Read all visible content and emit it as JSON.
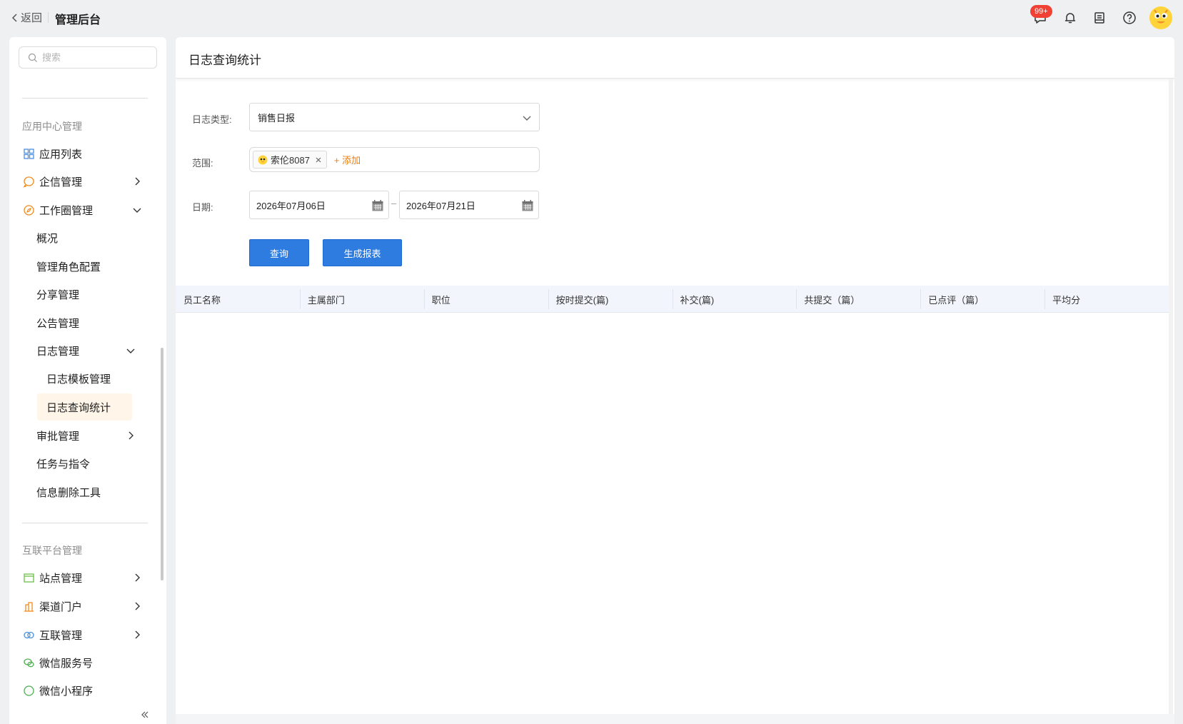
{
  "topbar": {
    "back_label": "返回",
    "app_title": "管理后台",
    "message_badge": "99+",
    "icons": [
      "chat-icon",
      "bell-icon",
      "notebook-icon",
      "help-icon",
      "avatar"
    ]
  },
  "sidebar": {
    "search_placeholder": "搜索",
    "group1_title": "应用中心管理",
    "items": [
      {
        "label": "应用列表",
        "icon": "grid-icon"
      },
      {
        "label": "企信管理",
        "icon": "message-icon"
      },
      {
        "label": "工作圈管理",
        "icon": "compass-icon"
      }
    ],
    "workcircle_children": [
      "概况",
      "管理角色配置",
      "分享管理",
      "公告管理",
      "日志管理"
    ],
    "log_children": [
      "日志模板管理",
      "日志查询统计"
    ],
    "more_children": [
      "审批管理",
      "任务与指令",
      "信息删除工具"
    ],
    "group2_title": "互联平台管理",
    "items2": [
      {
        "label": "站点管理",
        "icon": "window-icon"
      },
      {
        "label": "渠道门户",
        "icon": "building-icon"
      },
      {
        "label": "互联管理",
        "icon": "link-rings-icon"
      },
      {
        "label": "微信服务号",
        "icon": "wechat-icon"
      },
      {
        "label": "微信小程序",
        "icon": "miniprogram-icon"
      }
    ],
    "active_item": "日志查询统计",
    "colors": {
      "active_bg": "#fff5e8",
      "accent": "#e87f17"
    }
  },
  "main": {
    "page_title": "日志查询统计",
    "form": {
      "type_label": "日志类型:",
      "type_value": "销售日报",
      "range_label": "范围:",
      "range_tag": "索伦8087",
      "range_add": "+ 添加",
      "date_label": "日期:",
      "date_start": "2026年07月06日",
      "date_end": "2026年07月21日",
      "date_separator": "–"
    },
    "buttons": {
      "query": "查询",
      "report": "生成报表"
    },
    "table": {
      "columns": [
        "员工名称",
        "主属部门",
        "职位",
        "按时提交(篇)",
        "补交(篇)",
        "共提交（篇）",
        "已点评（篇）",
        "平均分"
      ],
      "rows": []
    },
    "colors": {
      "primary": "#2e7ce0",
      "header_bg": "#f2f6fc"
    }
  }
}
